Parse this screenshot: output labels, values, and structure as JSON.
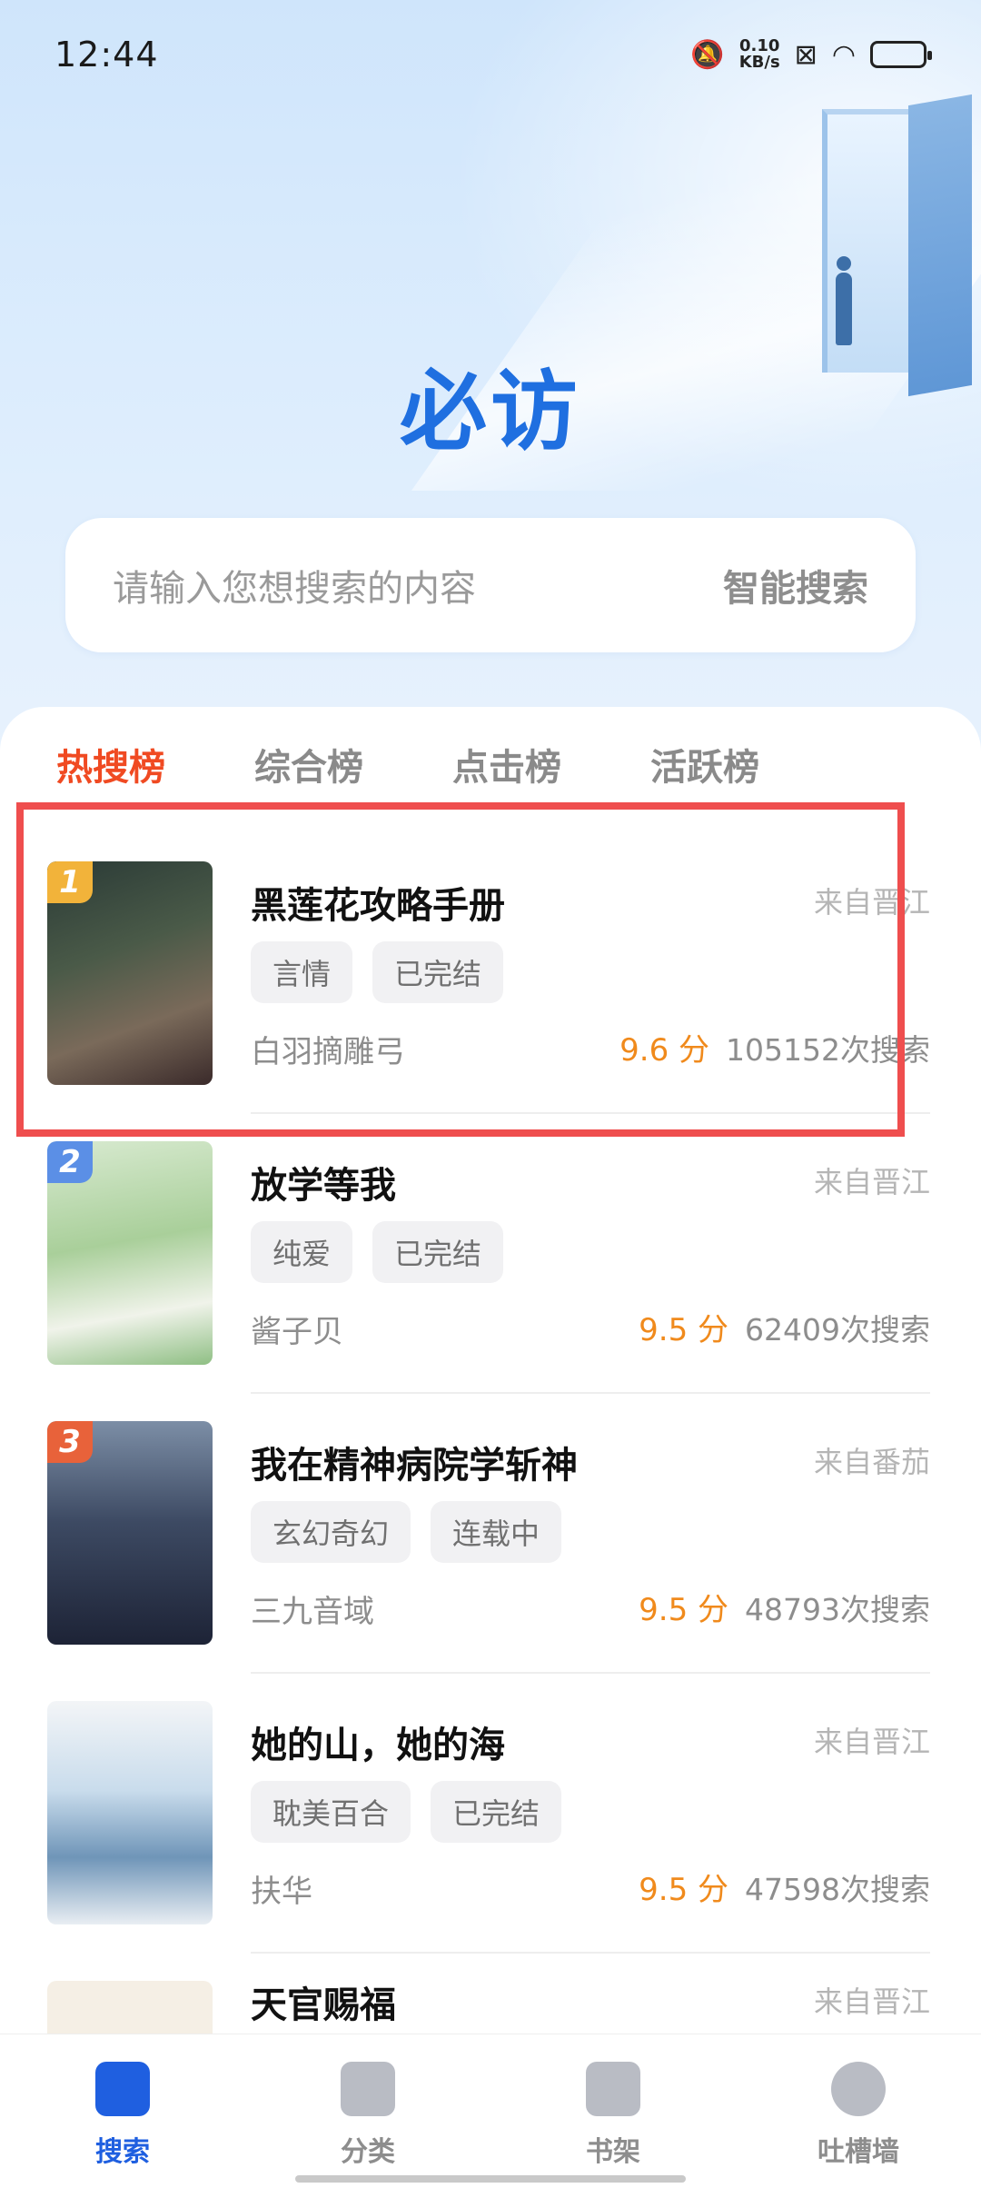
{
  "status_bar": {
    "time": "12:44",
    "net_speed_value": "0.10",
    "net_speed_unit": "KB/s"
  },
  "hero": {
    "logo_text": "必访"
  },
  "search": {
    "placeholder": "请输入您想搜索的内容",
    "action_label": "智能搜索"
  },
  "tabs": [
    {
      "label": "热搜榜",
      "active": true
    },
    {
      "label": "综合榜",
      "active": false
    },
    {
      "label": "点击榜",
      "active": false
    },
    {
      "label": "活跃榜",
      "active": false
    }
  ],
  "books": [
    {
      "rank": "1",
      "title": "黑莲花攻略手册",
      "source": "来自晋江",
      "tags": [
        "言情",
        "已完结"
      ],
      "author": "白羽摘雕弓",
      "score": "9.6 分",
      "searches": "105152次搜索"
    },
    {
      "rank": "2",
      "title": "放学等我",
      "source": "来自晋江",
      "tags": [
        "纯爱",
        "已完结"
      ],
      "author": "酱子贝",
      "score": "9.5 分",
      "searches": "62409次搜索"
    },
    {
      "rank": "3",
      "title": "我在精神病院学斩神",
      "source": "来自番茄",
      "tags": [
        "玄幻奇幻",
        "连载中"
      ],
      "author": "三九音域",
      "score": "9.5 分",
      "searches": "48793次搜索"
    },
    {
      "rank": "",
      "title": "她的山，她的海",
      "source": "来自晋江",
      "tags": [
        "耽美百合",
        "已完结"
      ],
      "author": "扶华",
      "score": "9.5 分",
      "searches": "47598次搜索"
    },
    {
      "rank": "",
      "title": "天官赐福",
      "source": "来自晋江",
      "tags": [],
      "author": "",
      "score": "",
      "searches": ""
    }
  ],
  "bottom_nav": [
    {
      "label": "搜索",
      "active": true
    },
    {
      "label": "分类",
      "active": false
    },
    {
      "label": "书架",
      "active": false
    },
    {
      "label": "吐槽墙",
      "active": false
    }
  ]
}
